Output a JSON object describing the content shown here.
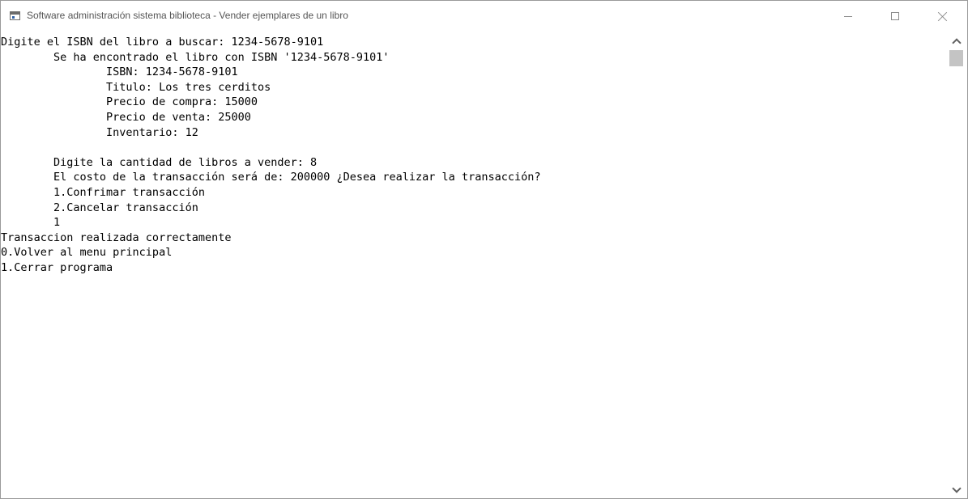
{
  "window": {
    "title": "Software administración sistema biblioteca - Vender ejemplares de un libro",
    "icon": "console-window-icon"
  },
  "console": {
    "lines": [
      "Digite el ISBN del libro a buscar: 1234-5678-9101",
      "        Se ha encontrado el libro con ISBN '1234-5678-9101'",
      "                ISBN: 1234-5678-9101",
      "                Titulo: Los tres cerditos",
      "                Precio de compra: 15000",
      "                Precio de venta: 25000",
      "                Inventario: 12",
      "",
      "        Digite la cantidad de libros a vender: 8",
      "        El costo de la transacción será de: 200000 ¿Desea realizar la transacción?",
      "        1.Confrimar transacción",
      "        2.Cancelar transacción",
      "        1",
      "Transaccion realizada correctamente",
      "0.Volver al menu principal",
      "1.Cerrar programa"
    ]
  },
  "scrollbar": {
    "up_icon": "chevron-up-icon",
    "down_icon": "chevron-down-icon"
  }
}
